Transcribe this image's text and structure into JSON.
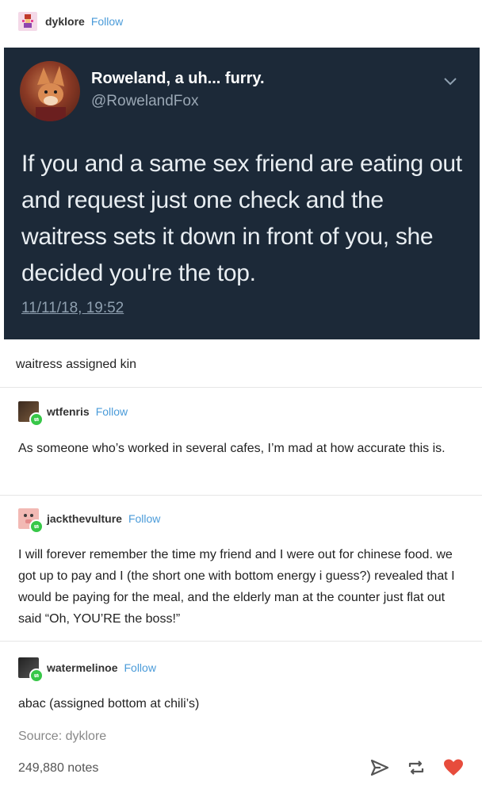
{
  "op": {
    "username": "dyklore",
    "follow": "Follow"
  },
  "tweet": {
    "display_name": "Roweland, a uh... furry.",
    "handle": "@RowelandFox",
    "text": "If you and a same sex friend are eating out and request just one check and the waitress sets it down in front of you, she decided you're the top.",
    "timestamp": "11/11/18, 19:52"
  },
  "op_caption": "waitress assigned kin",
  "reblogs": [
    {
      "username": "wtfenris",
      "follow": "Follow",
      "text": "As someone who’s worked in several cafes, I’m mad at how accurate this is."
    },
    {
      "username": "jackthevulture",
      "follow": "Follow",
      "text": "I will forever remember the time my friend and I were out for chinese food. we got up to pay and I (the short one with bottom energy i guess?) revealed that I would be paying for the meal, and the elderly man at the counter just flat out said “Oh, YOU’RE the boss!”"
    },
    {
      "username": "watermelinoe",
      "follow": "Follow",
      "text": "abac (assigned bottom at chili’s)"
    }
  ],
  "source": "Source: dyklore",
  "notes": "249,880 notes",
  "icons": {
    "share": "send-icon",
    "reblog": "reblog-icon",
    "like": "heart-icon"
  },
  "colors": {
    "follow": "#4a9bd9",
    "tweet_bg": "#1c2938",
    "like": "#e74c3c",
    "reblog_badge": "#37c748"
  }
}
